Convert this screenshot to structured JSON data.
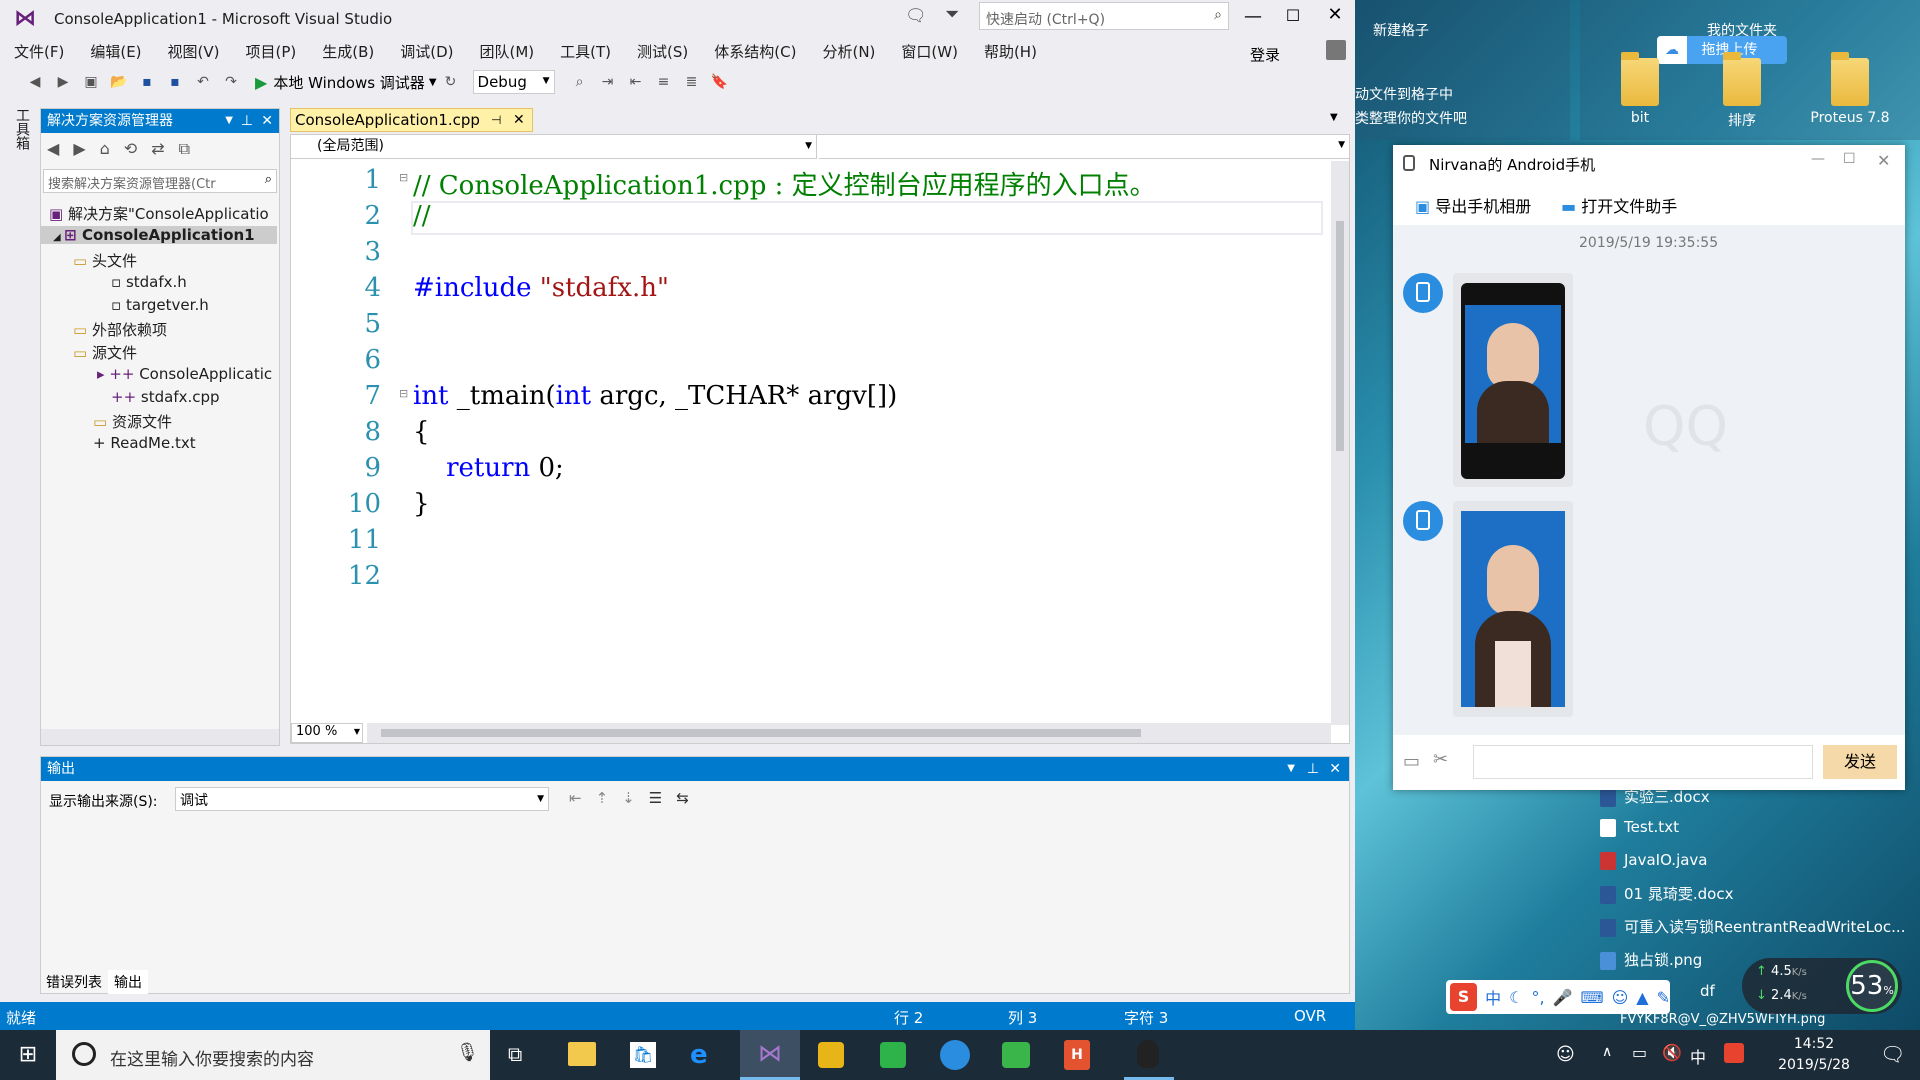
{
  "desktop": {
    "fence1_title": "新建格子",
    "fence1_hint1": "动文件到格子中",
    "fence1_hint2": "类整理你的文件吧",
    "fence2_title": "我的文件夹",
    "upload_label": "拖拽上传",
    "icons": [
      {
        "label": "bit"
      },
      {
        "label": "排序"
      },
      {
        "label": "Proteus 7.8"
      }
    ],
    "files": [
      {
        "label": "实验三.docx"
      },
      {
        "label": "Test.txt"
      },
      {
        "label": "JavaIO.java"
      },
      {
        "label": "01 晁琦雯.docx"
      },
      {
        "label": "可重入读写锁ReentrantReadWriteLoc..."
      },
      {
        "label": "独占锁.png"
      },
      {
        "label": "df"
      },
      {
        "label": "FVYKF8R@V_@ZHV5WFIYH.png"
      }
    ]
  },
  "vs": {
    "title": "ConsoleApplication1 - Microsoft Visual Studio",
    "quick_launch_placeholder": "快速启动 (Ctrl+Q)",
    "login": "登录",
    "menu": [
      "文件(F)",
      "编辑(E)",
      "视图(V)",
      "项目(P)",
      "生成(B)",
      "调试(D)",
      "团队(M)",
      "工具(T)",
      "测试(S)",
      "体系结构(C)",
      "分析(N)",
      "窗口(W)",
      "帮助(H)"
    ],
    "toolbar": {
      "debugger": "本地 Windows 调试器",
      "config": "Debug"
    },
    "toolbox_label": "工具箱",
    "solution_explorer": {
      "title": "解决方案资源管理器",
      "search_placeholder": "搜索解决方案资源管理器(Ctr",
      "items": [
        {
          "label": "解决方案\"ConsoleApplicatio"
        },
        {
          "label": "ConsoleApplication1"
        },
        {
          "label": "头文件"
        },
        {
          "label": "stdafx.h"
        },
        {
          "label": "targetver.h"
        },
        {
          "label": "外部依赖项"
        },
        {
          "label": "源文件"
        },
        {
          "label": "ConsoleApplicatic"
        },
        {
          "label": "stdafx.cpp"
        },
        {
          "label": "资源文件"
        },
        {
          "label": "ReadMe.txt"
        }
      ]
    },
    "editor": {
      "tab": "ConsoleApplication1.cpp",
      "scope": "(全局范围)",
      "zoom": "100 %",
      "line_numbers": [
        "1",
        "2",
        "3",
        "4",
        "5",
        "6",
        "7",
        "8",
        "9",
        "10",
        "11",
        "12"
      ],
      "lines": [
        [
          {
            "t": "// ConsoleApplication1.cpp : 定义控制台应用程序的入口点。",
            "c": "#008000"
          }
        ],
        [
          {
            "t": "//",
            "c": "#008000"
          }
        ],
        [],
        [
          {
            "t": "#include ",
            "c": "#0000ff"
          },
          {
            "t": "\"stdafx.h\"",
            "c": "#a31515"
          }
        ],
        [],
        [],
        [
          {
            "t": "int",
            "c": "#0000ff"
          },
          {
            "t": " _tmain(",
            "c": "#000"
          },
          {
            "t": "int",
            "c": "#0000ff"
          },
          {
            "t": " argc, _TCHAR* argv[])",
            "c": "#000"
          }
        ],
        [
          {
            "t": "{",
            "c": "#000"
          }
        ],
        [
          {
            "t": "    ",
            "c": "#000"
          },
          {
            "t": "return",
            "c": "#0000ff"
          },
          {
            "t": " 0;",
            "c": "#000"
          }
        ],
        [
          {
            "t": "}",
            "c": "#000"
          }
        ],
        [],
        []
      ]
    },
    "output": {
      "title": "输出",
      "source_label": "显示输出来源(S):",
      "source_value": "调试",
      "tabs": [
        "错误列表",
        "输出"
      ]
    },
    "status": {
      "ready": "就绪",
      "line": "行 2",
      "col": "列 3",
      "char": "字符 3",
      "ovr": "OVR"
    }
  },
  "qq": {
    "title": "Nirvana的 Android手机",
    "export_album": "导出手机相册",
    "open_assistant": "打开文件助手",
    "timestamp": "2019/5/19 19:35:55",
    "send": "发送",
    "watermark": "QQ"
  },
  "taskbar": {
    "search_placeholder": "在这里输入你要搜索的内容",
    "time": "14:52",
    "date": "2019/5/28",
    "ime": "中",
    "cpu_percent": "53",
    "net_up": "4.5",
    "net_down": "2.4",
    "net_unit": "K/s"
  }
}
